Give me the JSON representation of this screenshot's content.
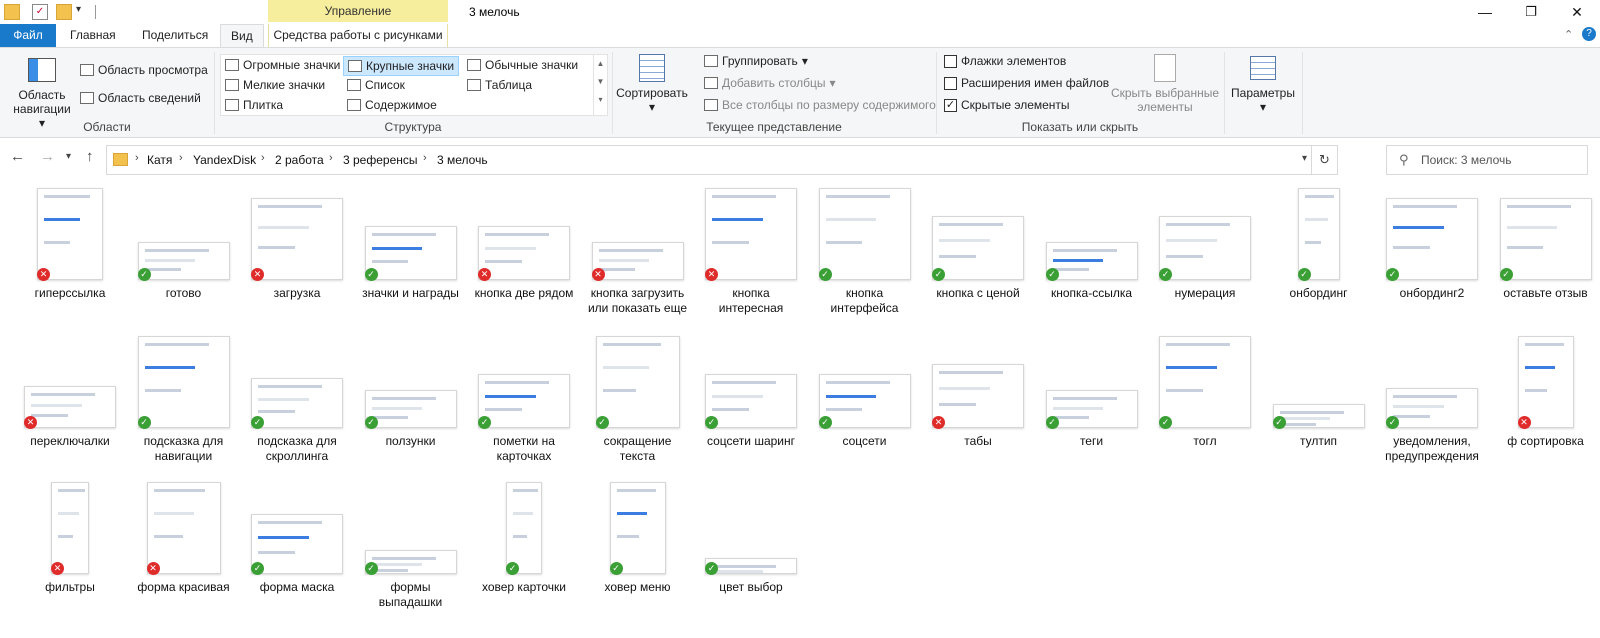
{
  "window": {
    "title": "3 мелочь",
    "context_header": "Управление",
    "min": "—",
    "max": "❐",
    "close": "✕"
  },
  "tabs": {
    "file": "Файл",
    "home": "Главная",
    "share": "Поделиться",
    "view": "Вид",
    "picture_tools": "Средства работы с рисунками"
  },
  "ribbon": {
    "panes": {
      "nav_pane": "Область навигации",
      "preview_pane": "Область просмотра",
      "details_pane": "Область сведений",
      "label": "Области"
    },
    "layout": {
      "extra_large": "Огромные значки",
      "large": "Крупные значки",
      "medium": "Обычные значки",
      "small": "Мелкие значки",
      "list": "Список",
      "table": "Таблица",
      "tiles": "Плитка",
      "content": "Содержимое",
      "label": "Структура"
    },
    "current_view": {
      "sort": "Сортировать",
      "group": "Группировать",
      "add_columns": "Добавить столбцы",
      "fit_columns": "Все столбцы по размеру содержимого",
      "label": "Текущее представление"
    },
    "show_hide": {
      "item_checkboxes": "Флажки элементов",
      "file_extensions": "Расширения имен файлов",
      "hidden_items": "Скрытые элементы",
      "hide_selected": "Скрыть выбранные элементы",
      "label": "Показать или скрыть",
      "hidden_items_checked": true
    },
    "options": "Параметры"
  },
  "address": {
    "crumbs": [
      "Катя",
      "YandexDisk",
      "2 работа",
      "3 референсы",
      "3 мелочь"
    ],
    "search_placeholder": "Поиск: 3 мелочь"
  },
  "files": [
    {
      "name": "гиперссылка",
      "status": "error"
    },
    {
      "name": "готово",
      "status": "ok"
    },
    {
      "name": "загрузка",
      "status": "error"
    },
    {
      "name": "значки и награды",
      "status": "ok"
    },
    {
      "name": "кнопка две рядом",
      "status": "error"
    },
    {
      "name": "кнопка загрузить или показать еще",
      "status": "error"
    },
    {
      "name": "кнопка интересная",
      "status": "error"
    },
    {
      "name": "кнопка интерфейса",
      "status": "ok"
    },
    {
      "name": "кнопка с ценой",
      "status": "ok"
    },
    {
      "name": "кнопка-ссылка",
      "status": "ok"
    },
    {
      "name": "нумерация",
      "status": "ok"
    },
    {
      "name": "онбординг",
      "status": "ok"
    },
    {
      "name": "онбординг2",
      "status": "ok"
    },
    {
      "name": "оставьте отзыв",
      "status": "ok"
    },
    {
      "name": "переключалки",
      "status": "error"
    },
    {
      "name": "подсказка для навигации",
      "status": "ok"
    },
    {
      "name": "подсказка для скроллинга",
      "status": "ok"
    },
    {
      "name": "ползунки",
      "status": "ok"
    },
    {
      "name": "пометки на карточках",
      "status": "ok"
    },
    {
      "name": "сокращение текста",
      "status": "ok"
    },
    {
      "name": "соцсети шаринг",
      "status": "ok"
    },
    {
      "name": "соцсети",
      "status": "ok"
    },
    {
      "name": "табы",
      "status": "error"
    },
    {
      "name": "теги",
      "status": "ok"
    },
    {
      "name": "тогл",
      "status": "ok"
    },
    {
      "name": "тултип",
      "status": "ok"
    },
    {
      "name": "уведомления, предупреждения",
      "status": "ok"
    },
    {
      "name": "ф сортировка",
      "status": "error"
    },
    {
      "name": "фильтры",
      "status": "error"
    },
    {
      "name": "форма красивая",
      "status": "error"
    },
    {
      "name": "форма маска",
      "status": "ok"
    },
    {
      "name": "формы выпадашки",
      "status": "ok"
    },
    {
      "name": "ховер карточки",
      "status": "ok"
    },
    {
      "name": "ховер меню",
      "status": "ok"
    },
    {
      "name": "цвет выбор",
      "status": "ok"
    }
  ],
  "icons": {
    "ok": "✓",
    "error": "✕"
  }
}
